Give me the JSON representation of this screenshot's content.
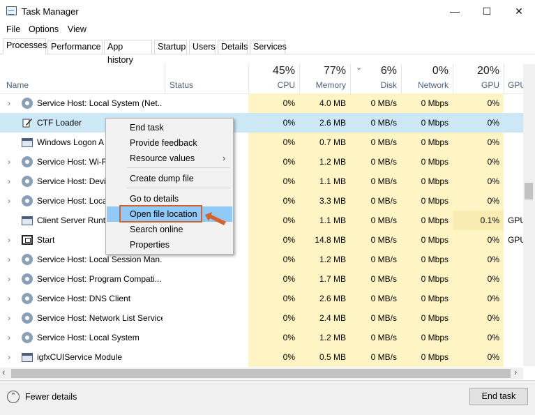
{
  "window": {
    "title": "Task Manager",
    "minimize_glyph": "—",
    "maximize_glyph": "☐",
    "close_glyph": "✕"
  },
  "menu": [
    "File",
    "Options",
    "View"
  ],
  "tabs": [
    "Processes",
    "Performance",
    "App history",
    "Startup",
    "Users",
    "Details",
    "Services"
  ],
  "active_tab": "Processes",
  "columns": {
    "name": "Name",
    "status": "Status",
    "cpu": {
      "pct": "45%",
      "label": "CPU"
    },
    "memory": {
      "pct": "77%",
      "label": "Memory"
    },
    "disk": {
      "pct": "6%",
      "label": "Disk"
    },
    "network": {
      "pct": "0%",
      "label": "Network"
    },
    "gpu": {
      "pct": "20%",
      "label": "GPU"
    },
    "gpu_engine": {
      "label": "GPU en"
    }
  },
  "rows": [
    {
      "expand": "›",
      "icon": "gear-icon",
      "name": "Service Host: Local System (Net...",
      "cpu": "0%",
      "memory": "4.0 MB",
      "disk": "0 MB/s",
      "network": "0 Mbps",
      "gpu": "0%",
      "gpu_engine": ""
    },
    {
      "expand": "",
      "icon": "ctf-loader-icon",
      "name": "CTF Loader",
      "cpu": "0%",
      "memory": "2.6 MB",
      "disk": "0 MB/s",
      "network": "0 Mbps",
      "gpu": "0%",
      "gpu_engine": "",
      "selected": true
    },
    {
      "expand": "",
      "icon": "window-icon",
      "name": "Windows Logon A",
      "cpu": "0%",
      "memory": "0.7 MB",
      "disk": "0 MB/s",
      "network": "0 Mbps",
      "gpu": "0%",
      "gpu_engine": ""
    },
    {
      "expand": "›",
      "icon": "gear-icon",
      "name": "Service Host: Wi-Fi",
      "cpu": "0%",
      "memory": "1.2 MB",
      "disk": "0 MB/s",
      "network": "0 Mbps",
      "gpu": "0%",
      "gpu_engine": ""
    },
    {
      "expand": "›",
      "icon": "gear-icon",
      "name": "Service Host: Devic",
      "cpu": "0%",
      "memory": "1.1 MB",
      "disk": "0 MB/s",
      "network": "0 Mbps",
      "gpu": "0%",
      "gpu_engine": ""
    },
    {
      "expand": "›",
      "icon": "gear-icon",
      "name": "Service Host: Local",
      "cpu": "0%",
      "memory": "3.3 MB",
      "disk": "0 MB/s",
      "network": "0 Mbps",
      "gpu": "0%",
      "gpu_engine": ""
    },
    {
      "expand": "",
      "icon": "window-icon",
      "name": "Client Server Runti",
      "cpu": "0%",
      "memory": "1.1 MB",
      "disk": "0 MB/s",
      "network": "0 Mbps",
      "gpu": "0.1%",
      "gpu_engine": "GPU"
    },
    {
      "expand": "›",
      "icon": "start-icon",
      "name": "Start",
      "cpu": "0%",
      "memory": "14.8 MB",
      "disk": "0 MB/s",
      "network": "0 Mbps",
      "gpu": "0%",
      "gpu_engine": "GPU"
    },
    {
      "expand": "›",
      "icon": "gear-icon",
      "name": "Service Host: Local Session Man...",
      "cpu": "0%",
      "memory": "1.2 MB",
      "disk": "0 MB/s",
      "network": "0 Mbps",
      "gpu": "0%",
      "gpu_engine": ""
    },
    {
      "expand": "›",
      "icon": "gear-icon",
      "name": "Service Host: Program Compati...",
      "cpu": "0%",
      "memory": "1.7 MB",
      "disk": "0 MB/s",
      "network": "0 Mbps",
      "gpu": "0%",
      "gpu_engine": ""
    },
    {
      "expand": "›",
      "icon": "gear-icon",
      "name": "Service Host: DNS Client",
      "cpu": "0%",
      "memory": "2.6 MB",
      "disk": "0 MB/s",
      "network": "0 Mbps",
      "gpu": "0%",
      "gpu_engine": ""
    },
    {
      "expand": "›",
      "icon": "gear-icon",
      "name": "Service Host: Network List Service",
      "cpu": "0%",
      "memory": "2.4 MB",
      "disk": "0 MB/s",
      "network": "0 Mbps",
      "gpu": "0%",
      "gpu_engine": ""
    },
    {
      "expand": "›",
      "icon": "gear-icon",
      "name": "Service Host: Local System",
      "cpu": "0%",
      "memory": "1.2 MB",
      "disk": "0 MB/s",
      "network": "0 Mbps",
      "gpu": "0%",
      "gpu_engine": ""
    },
    {
      "expand": "›",
      "icon": "window-icon",
      "name": "igfxCUIService Module",
      "cpu": "0%",
      "memory": "0.5 MB",
      "disk": "0 MB/s",
      "network": "0 Mbps",
      "gpu": "0%",
      "gpu_engine": ""
    }
  ],
  "context_menu": {
    "items": [
      "End task",
      "Provide feedback",
      "Resource values",
      "Create dump file",
      "Go to details",
      "Open file location",
      "Search online",
      "Properties"
    ],
    "submenu_glyph": "›",
    "highlighted": "Open file location"
  },
  "footer": {
    "fewer_details": "Fewer details",
    "fewer_glyph": "⌃",
    "end_task": "End task"
  },
  "scroll_glyphs": {
    "left": "‹",
    "right": "›"
  },
  "colors": {
    "usage_highlight": "#fff4c4",
    "selection": "#cce8f7",
    "menu_highlight": "#91c9f7",
    "callout": "#d2632d"
  }
}
